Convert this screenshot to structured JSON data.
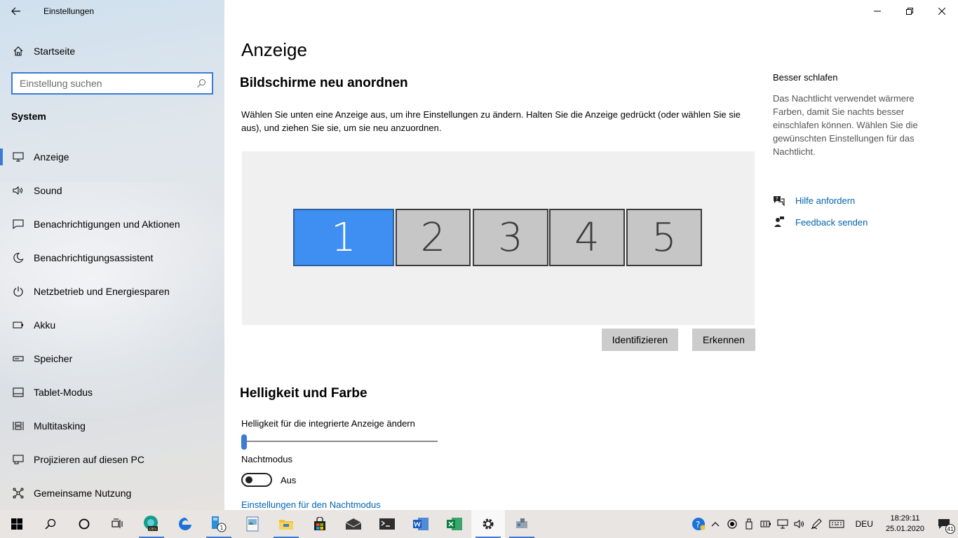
{
  "window": {
    "title": "Einstellungen"
  },
  "sidebar": {
    "home_label": "Startseite",
    "search_placeholder": "Einstellung suchen",
    "section_title": "System",
    "items": [
      {
        "label": "Anzeige",
        "icon": "monitor-icon",
        "active": true
      },
      {
        "label": "Sound",
        "icon": "speaker-icon"
      },
      {
        "label": "Benachrichtigungen und Aktionen",
        "icon": "message-icon"
      },
      {
        "label": "Benachrichtigungsassistent",
        "icon": "moon-icon"
      },
      {
        "label": "Netzbetrieb und Energiesparen",
        "icon": "power-icon"
      },
      {
        "label": "Akku",
        "icon": "battery-icon"
      },
      {
        "label": "Speicher",
        "icon": "storage-icon"
      },
      {
        "label": "Tablet-Modus",
        "icon": "tablet-icon"
      },
      {
        "label": "Multitasking",
        "icon": "multitasking-icon"
      },
      {
        "label": "Projizieren auf diesen PC",
        "icon": "project-icon"
      },
      {
        "label": "Gemeinsame Nutzung",
        "icon": "share-icon"
      }
    ]
  },
  "main": {
    "page_title": "Anzeige",
    "arrange_heading": "Bildschirme neu anordnen",
    "arrange_description": "Wählen Sie unten eine Anzeige aus, um ihre Einstellungen zu ändern. Halten Sie die Anzeige gedrückt (oder wählen Sie sie aus), und ziehen Sie sie, um sie neu anzuordnen.",
    "monitors": [
      "1",
      "2",
      "3",
      "4",
      "5"
    ],
    "identify_button": "Identifizieren",
    "detect_button": "Erkennen",
    "brightness_heading": "Helligkeit und Farbe",
    "brightness_label": "Helligkeit für die integrierte Anzeige ändern",
    "brightness_value": 0,
    "night_mode_label": "Nachtmodus",
    "night_mode_state": "Aus",
    "night_mode_settings_link": "Einstellungen für den Nachtmodus"
  },
  "aside": {
    "title": "Besser schlafen",
    "text": "Das Nachtlicht verwendet wärmere Farben, damit Sie nachts besser einschlafen können. Wählen Sie die gewünschten Einstellungen für das Nachtlicht.",
    "help_link": "Hilfe anfordern",
    "feedback_link": "Feedback senden"
  },
  "taskbar": {
    "language": "DEU",
    "time": "18:29:11",
    "date": "25.01.2020",
    "notification_count": "41",
    "edge_dev_badge": "DEV",
    "file_manager_badge": "1"
  },
  "colors": {
    "accent": "#3b7bd6",
    "primary_monitor": "#3f8ef2",
    "secondary_monitor": "#c6c6c6",
    "link": "#0063b1"
  }
}
